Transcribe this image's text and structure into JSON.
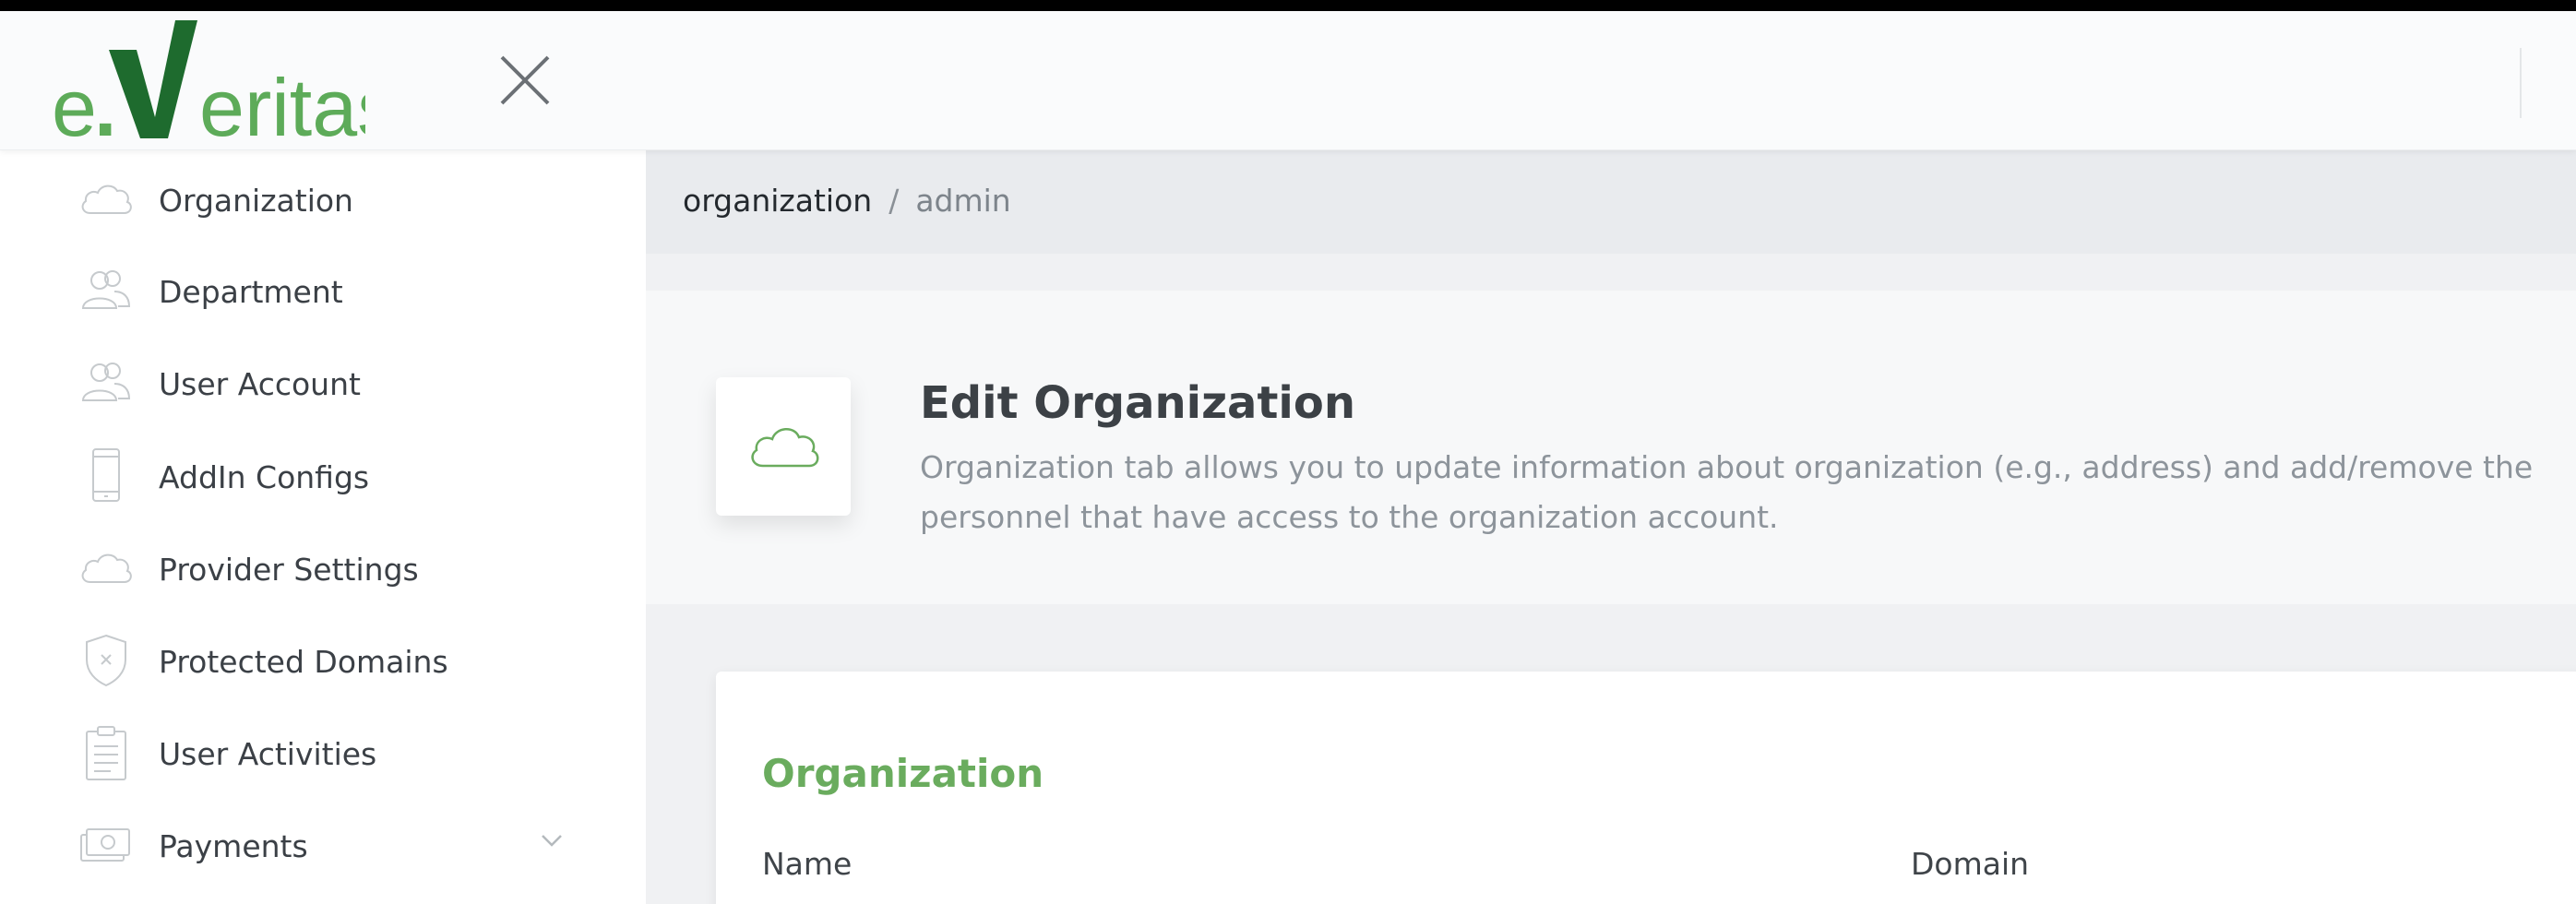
{
  "brand": {
    "logo_text_prefix": "e",
    "logo_text_v": "V",
    "logo_text_suffix": "eritas",
    "color_green": "#6aac5e",
    "color_dark_green": "#1e6b2e"
  },
  "header": {
    "close_icon": "close-icon"
  },
  "sidebar": {
    "items": [
      {
        "label": "Organization",
        "icon": "cloud-icon"
      },
      {
        "label": "Department",
        "icon": "users-icon"
      },
      {
        "label": "User Account",
        "icon": "users-icon"
      },
      {
        "label": "AddIn Configs",
        "icon": "mobile-icon"
      },
      {
        "label": "Provider Settings",
        "icon": "cloud-icon"
      },
      {
        "label": "Protected Domains",
        "icon": "shield-icon"
      },
      {
        "label": "User Activities",
        "icon": "clipboard-icon"
      },
      {
        "label": "Payments",
        "icon": "money-icon",
        "expandable": true
      }
    ]
  },
  "breadcrumb": {
    "root": "organization",
    "separator": "/",
    "current": "admin"
  },
  "page": {
    "title": "Edit Organization",
    "description": "Organization tab allows you to update information about organization (e.g., address) and add/remove the personnel that have access to the organization account.",
    "icon": "cloud-icon"
  },
  "form": {
    "section_title": "Organization",
    "name_label": "Name",
    "domain_label": "Domain"
  }
}
